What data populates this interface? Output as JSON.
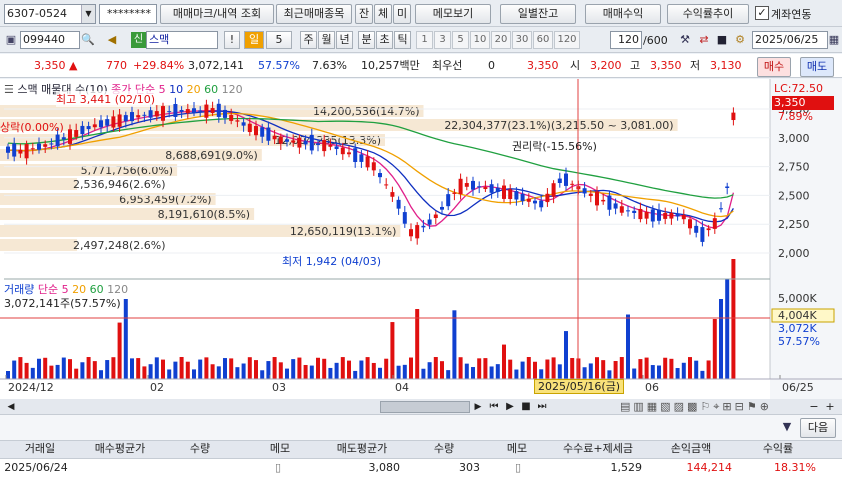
{
  "toolbar1": {
    "account": "6307-0524",
    "password": "********",
    "tabs": [
      "매매마크/내역 조회",
      "최근매매종목",
      "잔",
      "체",
      "미",
      "메모보기",
      "일별잔고",
      "매매수익",
      "수익률추이"
    ],
    "checkbox_label": "계좌연동",
    "checkbox_checked": true
  },
  "toolbar2": {
    "code": "099440",
    "stock_name": "스맥",
    "name_badge": "신",
    "excl": "!",
    "period": "일",
    "period_num": "5",
    "periods": [
      "주",
      "월",
      "년",
      "분",
      "초",
      "틱"
    ],
    "nums": [
      "1",
      "3",
      "5",
      "10",
      "20",
      "30",
      "60",
      "120"
    ],
    "count": "120",
    "count_max": "/600",
    "date": "2025/06/25"
  },
  "quote": {
    "price": "3,350",
    "change": "770",
    "change_pct": "+29.84%",
    "volume": "3,072,141",
    "vol_ratio": "57.57%",
    "turnover": "7.63%",
    "amount": "10,257백만",
    "pref_label": "최우선",
    "pref_val": "0",
    "pref_price": "3,350",
    "open_label": "시",
    "open": "3,200",
    "high_label": "고",
    "high": "3,350",
    "low_label": "저",
    "low": "3,130",
    "buy": "매수",
    "sell": "매도"
  },
  "price_chart": {
    "legend_name": "스맥 매물대 수(10)",
    "legend_ma": "종가 단순",
    "ma_periods": [
      "5",
      "10",
      "20",
      "60",
      "120"
    ],
    "ma_colors": [
      "#e0208a",
      "#1030c0",
      "#f0a000",
      "#20a040",
      "#888888"
    ],
    "lc_label": "LC:72.50",
    "last_price": "3,350",
    "last_pct": "7.89%",
    "high_note": "최고 3,441 (02/10)",
    "low_note": "최저 1,942 (04/03)",
    "right_note": "권리락(-15.56%)",
    "left_note": "상락(0.00%)",
    "y_ticks": [
      "3,250",
      "3,000",
      "2,750",
      "2,500",
      "2,250",
      "2,000"
    ],
    "vprofile": [
      {
        "label": "14,200,536(14.7%)",
        "w": 0.55
      },
      {
        "label": "22,304,377(23.1%)(3,215.50 ~ 3,081.00)",
        "w": 0.88
      },
      {
        "label": "12,004,235(13.3%)",
        "w": 0.5
      },
      {
        "label": "8,688,691(9.0%)",
        "w": 0.34
      },
      {
        "label": "5,771,756(6.0%)",
        "w": 0.23
      },
      {
        "label": "2,536,946(2.6%)",
        "w": 0.1
      },
      {
        "label": "6,953,459(7.2%)",
        "w": 0.28
      },
      {
        "label": "8,191,610(8.5%)",
        "w": 0.33
      },
      {
        "label": "12,650,119(13.1%)",
        "w": 0.52
      },
      {
        "label": "2,497,248(2.6%)",
        "w": 0.1
      }
    ]
  },
  "volume_chart": {
    "legend_name": "거래량",
    "legend_ma": "단순",
    "ma_periods": [
      "5",
      "20",
      "60",
      "120"
    ],
    "vol_text": "3,072,141주(57.57%)",
    "y_ticks": [
      "5,000K",
      "4,004K",
      "3,072K",
      "57.57%"
    ],
    "x_labels": [
      "2024/12",
      "02",
      "03",
      "04",
      "06",
      "06/25"
    ],
    "cursor_date": "2025/05/16(금)"
  },
  "table": {
    "headers": [
      "거래일",
      "매수평균가",
      "수량",
      "메모",
      "매도평균가",
      "수량",
      "메모",
      "수수료+제세금",
      "손익금액",
      "수익률"
    ],
    "rows": [
      [
        "2025/06/24",
        "",
        "",
        "",
        "3,080",
        "303",
        "",
        "1,529",
        "144,214",
        "18.31%"
      ]
    ],
    "action_button": "다음"
  }
}
